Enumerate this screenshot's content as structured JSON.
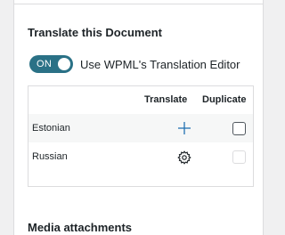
{
  "translate_section": {
    "title": "Translate this Document",
    "toggle": {
      "state_label": "ON",
      "label": "Use WPML's Translation Editor",
      "on": true
    },
    "table": {
      "headers": {
        "translate": "Translate",
        "duplicate": "Duplicate"
      },
      "rows": [
        {
          "language": "Estonian",
          "action_icon": "plus-icon",
          "duplicate_checked": false,
          "duplicate_enabled": true
        },
        {
          "language": "Russian",
          "action_icon": "gear-icon",
          "duplicate_checked": false,
          "duplicate_enabled": false
        }
      ]
    }
  },
  "media_section": {
    "title": "Media attachments"
  },
  "colors": {
    "toggle_bg": "#2a7186",
    "icon_blue": "#2271b1",
    "row_alt": "#f6f7f7"
  }
}
